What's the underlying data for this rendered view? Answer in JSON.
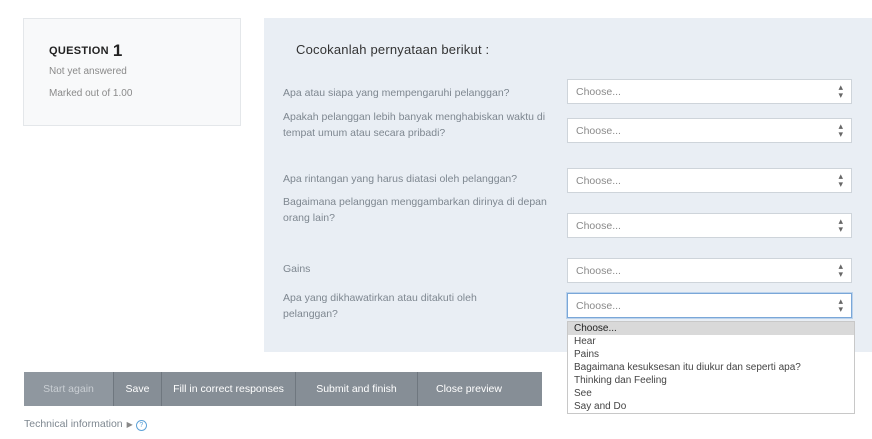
{
  "question": {
    "label": "QUESTION",
    "number": "1",
    "status": "Not yet answered",
    "marks": "Marked out of 1.00"
  },
  "prompt": "Cocokanlah pernyataan berikut :",
  "rows": [
    {
      "text": "Apa atau siapa yang mempengaruhi pelanggan?",
      "selected": "Choose..."
    },
    {
      "text": "Apakah pelanggan lebih banyak menghabiskan waktu di tempat umum atau secara pribadi?",
      "selected": "Choose..."
    },
    {
      "text": "Apa rintangan yang harus diatasi oleh pelanggan?",
      "selected": "Choose..."
    },
    {
      "text": "Bagaimana pelanggan menggambarkan dirinya di depan orang lain?",
      "selected": "Choose..."
    },
    {
      "text": "Gains",
      "selected": "Choose..."
    },
    {
      "text": "Apa yang dikhawatirkan atau ditakuti oleh pelanggan?",
      "selected": "Choose..."
    }
  ],
  "dropdown_options": [
    "Choose...",
    "Hear",
    "Pains",
    "Bagaimana kesuksesan itu diukur dan seperti apa?",
    "Thinking dan Feeling",
    "See",
    "Say and Do"
  ],
  "buttons": {
    "start_again": "Start again",
    "save": "Save",
    "fill": "Fill in correct responses",
    "submit": "Submit and finish",
    "close": "Close preview"
  },
  "technical_info": "Technical information",
  "icons": {
    "select_arrow": "up-down-arrow-icon",
    "expand": "triangle-right-icon",
    "help": "help-circle-icon"
  }
}
